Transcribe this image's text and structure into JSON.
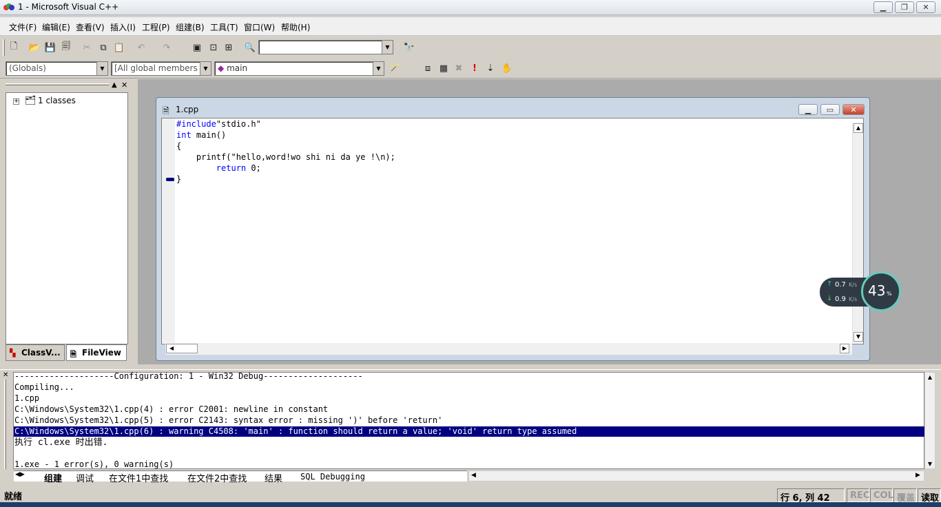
{
  "window": {
    "title": "1 - Microsoft Visual C++"
  },
  "menu": [
    "文件(F)",
    "编辑(E)",
    "查看(V)",
    "插入(I)",
    "工程(P)",
    "组建(B)",
    "工具(T)",
    "窗口(W)",
    "帮助(H)"
  ],
  "toolbar2": {
    "globals": "(Globals)",
    "members": "[All global members",
    "function": "main"
  },
  "workspace": {
    "tree_root": "1 classes",
    "tab_class": "ClassV...",
    "tab_file": "FileView"
  },
  "editor": {
    "title": "1.cpp",
    "lines": [
      {
        "kw": "#include",
        "text": "\"stdio.h\""
      },
      {
        "kw": "int",
        "text": " main()"
      },
      {
        "kw": "",
        "text": "{"
      },
      {
        "kw": "",
        "text": "    printf(\"hello,word!wo shi ni da ye !\\n);"
      },
      {
        "kw": "return",
        "indent": "        ",
        "text": " 0;"
      },
      {
        "kw": "",
        "text": "}"
      }
    ]
  },
  "output": {
    "lines": [
      "--------------------Configuration: 1 - Win32 Debug--------------------",
      "Compiling...",
      "1.cpp",
      "C:\\Windows\\System32\\1.cpp(4) : error C2001: newline in constant",
      "C:\\Windows\\System32\\1.cpp(5) : error C2143: syntax error : missing ')' before 'return'",
      "C:\\Windows\\System32\\1.cpp(6) : warning C4508: 'main' : function should return a value; 'void' return type assumed",
      "执行 cl.exe 时出错.",
      "",
      "1.exe - 1 error(s), 0 warning(s)"
    ],
    "selected_index": 5,
    "tabs": [
      "组建",
      "调试",
      "在文件1中查找",
      "在文件2中查找",
      "结果",
      "SQL Debugging"
    ]
  },
  "status": {
    "text": "就绪",
    "position": "行 6, 列 42",
    "rec": "REC",
    "col": "COL",
    "ovr": "覆盖",
    "read": "读取"
  },
  "net_widget": {
    "up": "0.7",
    "down": "0.9",
    "unit": "K/s",
    "percent": "43",
    "percent_sign": "%"
  },
  "colors": {
    "selection": "#000080",
    "keyword": "#0000ff",
    "mdi_bg": "#ababab"
  }
}
